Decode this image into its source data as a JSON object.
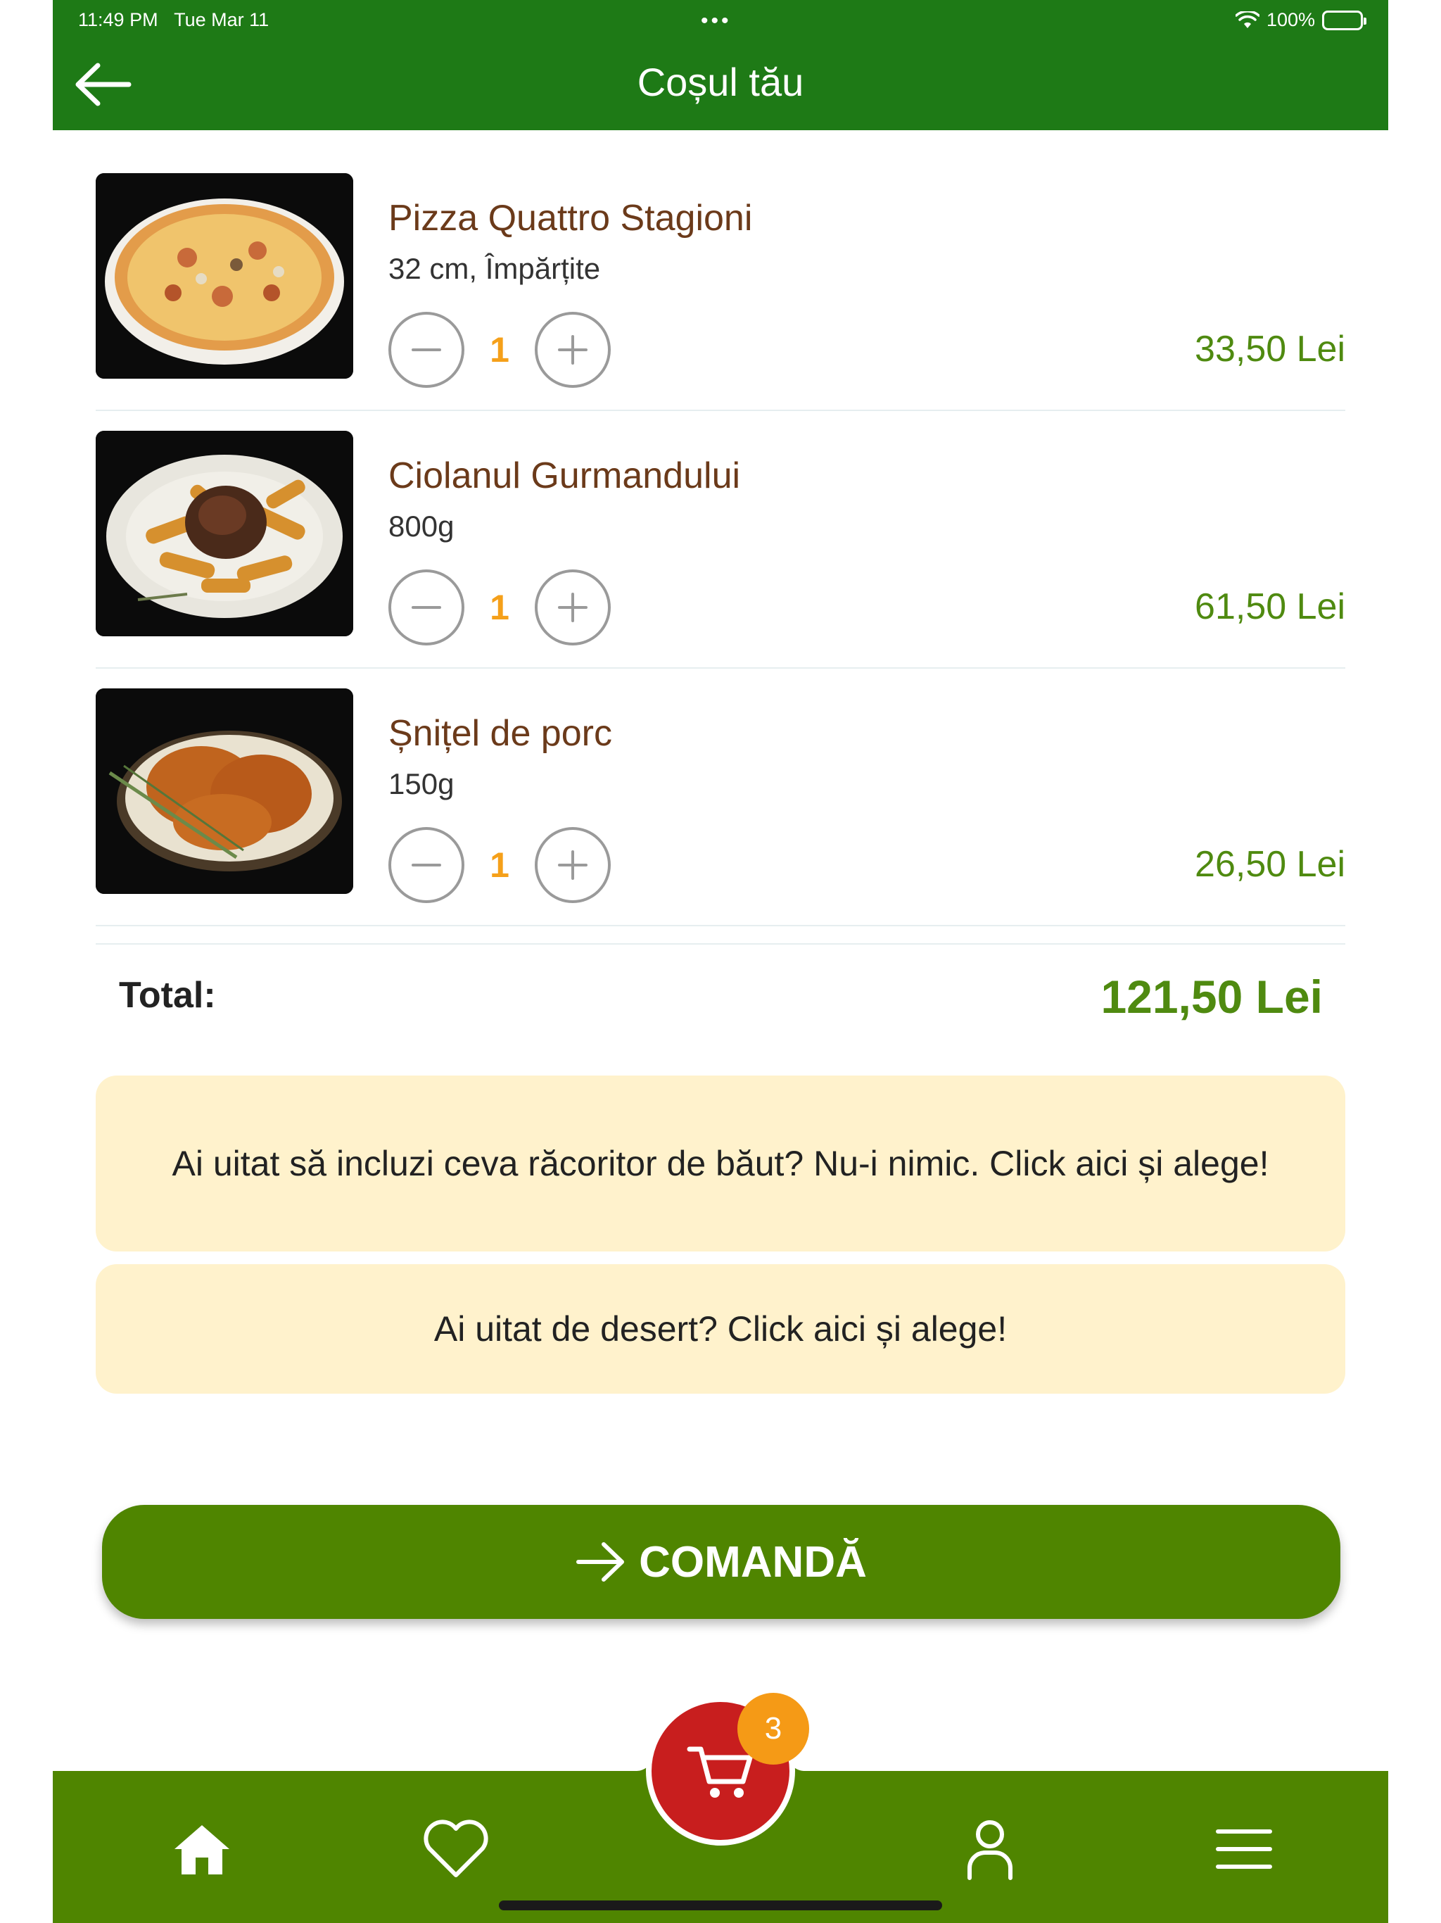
{
  "status_bar": {
    "time": "11:49 PM",
    "date": "Tue Mar 11",
    "dots": "•••",
    "battery": "100%"
  },
  "header": {
    "title": "Coșul tău"
  },
  "cart": {
    "items": [
      {
        "name": "Pizza Quattro Stagioni",
        "details": "32 cm, Împărțite",
        "quantity": "1",
        "price": "33,50 Lei",
        "image": "pizza-image"
      },
      {
        "name": "Ciolanul Gurmandului",
        "details": "800g",
        "quantity": "1",
        "price": "61,50 Lei",
        "image": "pork-knuckle-image"
      },
      {
        "name": "Șnițel de porc",
        "details": "150g",
        "quantity": "1",
        "price": "26,50 Lei",
        "image": "schnitzel-image"
      }
    ],
    "total_label": "Total:",
    "total_value": "121,50 Lei"
  },
  "promos": {
    "drinks": "Ai uitat să incluzi ceva răcoritor de băut? Nu-i nimic. Click aici și alege!",
    "dessert": "Ai uitat de desert? Click aici și alege!"
  },
  "order_button": {
    "label": "COMANDĂ"
  },
  "bottom_nav": {
    "items": [
      "home-icon",
      "heart-icon",
      "cart-icon",
      "user-icon",
      "menu-icon"
    ],
    "cart_badge": "3"
  },
  "colors": {
    "header_green": "#1e7a16",
    "nav_green": "#4f8500",
    "price_green": "#4f8a10",
    "item_name_brown": "#6b3a1a",
    "qty_orange": "#f5a01a",
    "promo_bg": "#fff2cc",
    "cart_red": "#c81e1e",
    "badge_orange": "#f59a16"
  }
}
